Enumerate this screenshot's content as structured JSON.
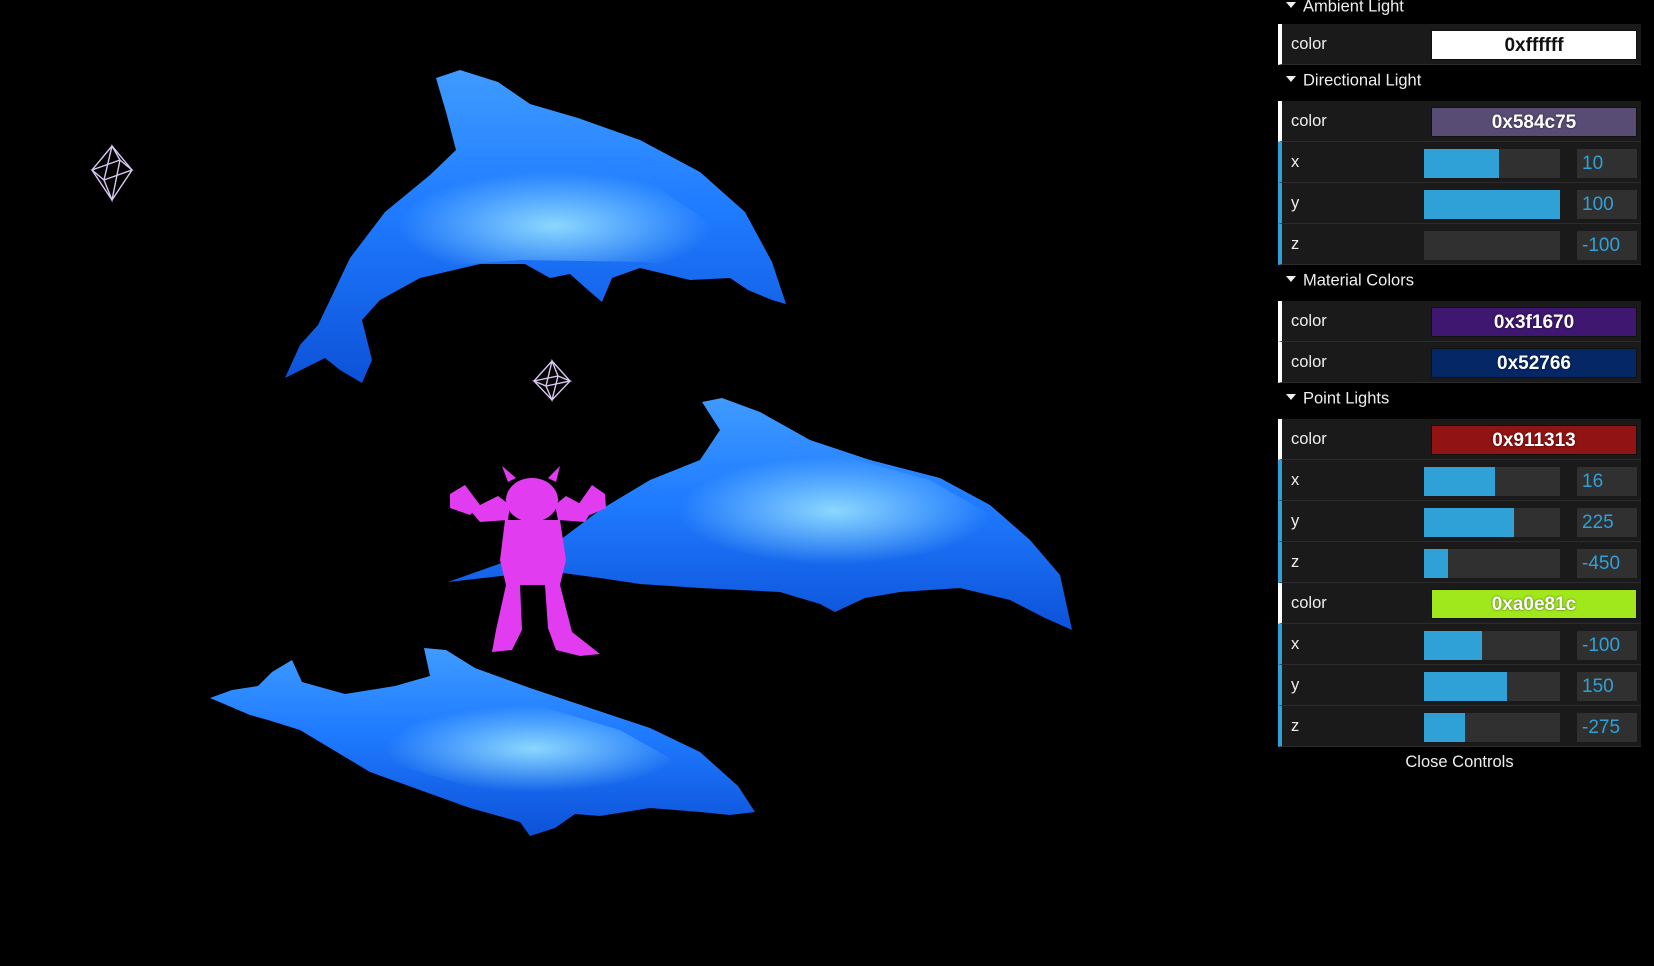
{
  "scene": {
    "background": "#000000",
    "objects": [
      {
        "name": "dolphin",
        "color": "#1f78ff"
      },
      {
        "name": "dolphin",
        "color": "#1f78ff"
      },
      {
        "name": "dolphin",
        "color": "#1f78ff"
      },
      {
        "name": "monster",
        "color": "#e23cf0"
      },
      {
        "name": "point-light-helper",
        "color": "#d8c8f0"
      },
      {
        "name": "point-light-helper",
        "color": "#d8c8f0"
      }
    ]
  },
  "gui": {
    "folders": [
      {
        "title": "Ambient Light",
        "controllers": [
          {
            "type": "color",
            "label": "color",
            "value": "0xffffff",
            "swatch": "#ffffff"
          }
        ]
      },
      {
        "title": "Directional Light",
        "controllers": [
          {
            "type": "color",
            "label": "color",
            "value": "0x584c75",
            "swatch": "#584c75"
          },
          {
            "type": "number",
            "label": "x",
            "value": "10",
            "fraction": 0.55
          },
          {
            "type": "number",
            "label": "y",
            "value": "100",
            "fraction": 1.0
          },
          {
            "type": "number",
            "label": "z",
            "value": "-100",
            "fraction": 0.0
          }
        ]
      },
      {
        "title": "Material Colors",
        "controllers": [
          {
            "type": "color",
            "label": "color",
            "value": "0x3f1670",
            "swatch": "#3f1670"
          },
          {
            "type": "color",
            "label": "color",
            "value": "0x52766",
            "swatch": "#052766"
          }
        ]
      },
      {
        "title": "Point Lights",
        "controllers": [
          {
            "type": "color",
            "label": "color",
            "value": "0x911313",
            "swatch": "#911313"
          },
          {
            "type": "number",
            "label": "x",
            "value": "16",
            "fraction": 0.52
          },
          {
            "type": "number",
            "label": "y",
            "value": "225",
            "fraction": 0.66
          },
          {
            "type": "number",
            "label": "z",
            "value": "-450",
            "fraction": 0.18
          },
          {
            "type": "color",
            "label": "color",
            "value": "0xa0e81c",
            "swatch": "#a0e81c"
          },
          {
            "type": "number",
            "label": "x",
            "value": "-100",
            "fraction": 0.43
          },
          {
            "type": "number",
            "label": "y",
            "value": "150",
            "fraction": 0.61
          },
          {
            "type": "number",
            "label": "z",
            "value": "-275",
            "fraction": 0.3
          }
        ]
      }
    ],
    "close_label": "Close Controls",
    "accent": "#2fa1d6"
  }
}
